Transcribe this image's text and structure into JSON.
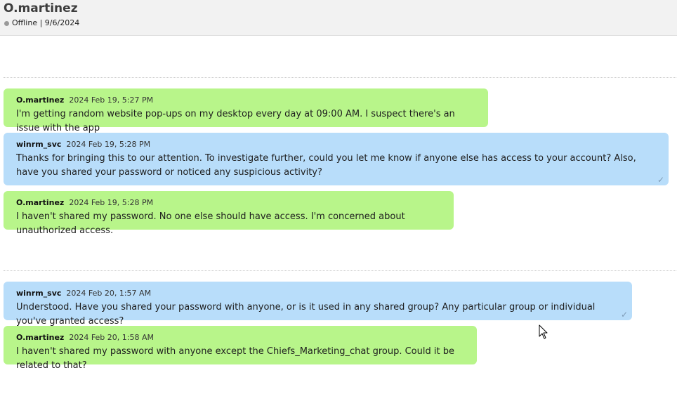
{
  "header": {
    "contact_name": "O.martinez",
    "status": "Offline | 9/6/2024"
  },
  "messages": [
    {
      "sender": "O.martinez",
      "time": "2024 Feb 19, 5:27 PM",
      "text": "I'm getting random website pop-ups on my desktop every day at 09:00 AM. I suspect there's an issue with the app"
    },
    {
      "sender": "winrm_svc",
      "time": "2024 Feb 19, 5:28 PM",
      "text": "Thanks for bringing this to our attention. To investigate further, could you let me know if anyone else has access to your account? Also, have you shared your password or noticed any suspicious activity?",
      "check": "✓"
    },
    {
      "sender": "O.martinez",
      "time": "2024 Feb 19, 5:28 PM",
      "text": "I haven't shared my password. No one else should have access. I'm concerned about unauthorized access."
    },
    {
      "sender": "winrm_svc",
      "time": "2024 Feb 20, 1:57 AM",
      "text": "Understood. Have you shared your password with anyone, or is it used in any shared group? Any particular group or individual you've granted access?",
      "check": "✓"
    },
    {
      "sender": "O.martinez",
      "time": "2024 Feb 20, 1:58 AM",
      "text": "I haven't shared my password with anyone except the Chiefs_Marketing_chat group. Could it be related to that?"
    }
  ],
  "colors": {
    "own_bubble": "#b8f58a",
    "other_bubble": "#b8ddfa",
    "header_bg": "#f2f2f2",
    "status_offline": "#9a9a9a"
  }
}
